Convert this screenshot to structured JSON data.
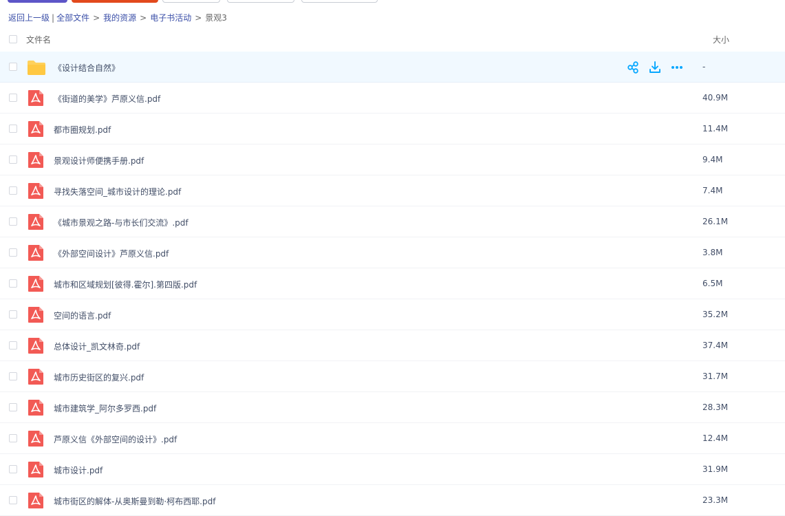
{
  "breadcrumb": {
    "back": "返回上一级",
    "divider": "|",
    "items": [
      "全部文件",
      "我的资源",
      "电子书活动"
    ],
    "current": "景观3",
    "arrow": ">"
  },
  "columns": {
    "name": "文件名",
    "size": "大小"
  },
  "colors": {
    "folder": "#ffd15b",
    "pdf": "#f25a55",
    "accent": "#06a7ff",
    "selected_row": "#f1f9ff"
  },
  "files": [
    {
      "name": "《设计结合自然》",
      "size": "-",
      "type": "folder-icon",
      "selected": true
    },
    {
      "name": "《街道的美学》芦原义信.pdf",
      "size": "40.9M",
      "type": "pdf-icon"
    },
    {
      "name": "都市圈规划.pdf",
      "size": "11.4M",
      "type": "pdf-icon"
    },
    {
      "name": "景观设计师便携手册.pdf",
      "size": "9.4M",
      "type": "pdf-icon"
    },
    {
      "name": "寻找失落空间_城市设计的理论.pdf",
      "size": "7.4M",
      "type": "pdf-icon"
    },
    {
      "name": "《城市景观之路-与市长们交流》.pdf",
      "size": "26.1M",
      "type": "pdf-icon"
    },
    {
      "name": "《外部空间设计》芦原义信.pdf",
      "size": "3.8M",
      "type": "pdf-icon"
    },
    {
      "name": "城市和区域规划[彼得.霍尔].第四版.pdf",
      "size": "6.5M",
      "type": "pdf-icon"
    },
    {
      "name": "空间的语言.pdf",
      "size": "35.2M",
      "type": "pdf-icon"
    },
    {
      "name": "总体设计_凯文林奇.pdf",
      "size": "37.4M",
      "type": "pdf-icon"
    },
    {
      "name": "城市历史街区的复兴.pdf",
      "size": "31.7M",
      "type": "pdf-icon"
    },
    {
      "name": "城市建筑学_阿尔多罗西.pdf",
      "size": "28.3M",
      "type": "pdf-icon"
    },
    {
      "name": "芦原义信《外部空间的设计》.pdf",
      "size": "12.4M",
      "type": "pdf-icon"
    },
    {
      "name": "城市设计.pdf",
      "size": "31.9M",
      "type": "pdf-icon"
    },
    {
      "name": "城市街区的解体-从奥斯曼到勒·柯布西耶.pdf",
      "size": "23.3M",
      "type": "pdf-icon"
    }
  ],
  "row_actions": [
    "share-icon",
    "download-icon",
    "more-icon"
  ]
}
